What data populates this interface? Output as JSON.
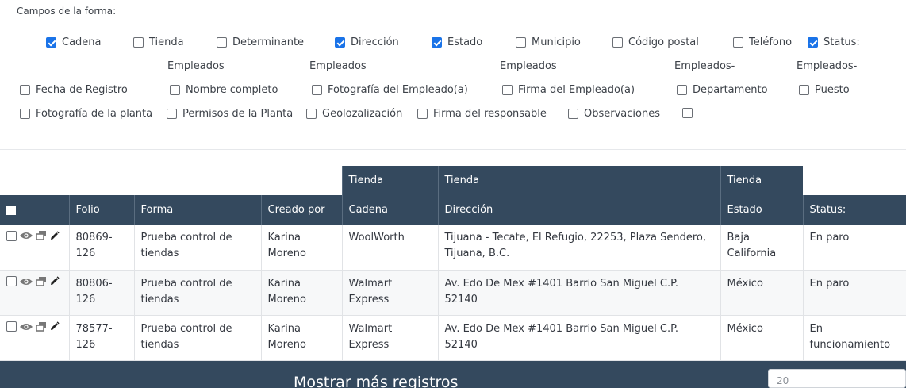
{
  "fields": {
    "title": "Campos de la forma:",
    "checkboxes": [
      {
        "label": "Cadena",
        "checked": true
      },
      {
        "label": "Tienda",
        "checked": false
      },
      {
        "label": "Determinante",
        "checked": false
      },
      {
        "label": "Dirección",
        "checked": true
      },
      {
        "label": "Estado",
        "checked": true
      },
      {
        "label": "Municipio",
        "checked": false
      },
      {
        "label": "Código postal",
        "checked": false
      },
      {
        "label": "Teléfono",
        "checked": false
      },
      {
        "label": "Status:",
        "checked": true
      },
      {
        "label": "Fecha de Registro",
        "checked": false
      },
      {
        "label": "Nombre completo",
        "checked": false
      },
      {
        "label": "Fotografía del Empleado(a)",
        "checked": false
      },
      {
        "label": "Firma del Empleado(a)",
        "checked": false
      },
      {
        "label": "Departamento",
        "checked": false
      },
      {
        "label": "Puesto",
        "checked": false
      },
      {
        "label": "Fotografía de la planta",
        "checked": false
      },
      {
        "label": "Permisos de la Planta",
        "checked": false
      },
      {
        "label": "Geolozalización",
        "checked": false
      },
      {
        "label": "Firma del responsable",
        "checked": false
      },
      {
        "label": "Observaciones",
        "checked": false
      },
      {
        "label": "",
        "checked": false
      }
    ],
    "group_labels": [
      "Empleados",
      "Empleados",
      "Empleados",
      "Empleados-",
      "Empleados-"
    ]
  },
  "table": {
    "group_headers": [
      "Tienda",
      "Tienda",
      "Tienda"
    ],
    "headers": [
      "Folio",
      "Forma",
      "Creado por",
      "Cadena",
      "Dirección",
      "Estado",
      "Status:"
    ],
    "rows": [
      {
        "folio": "80869-126",
        "forma": "Prueba control de tiendas",
        "creado": "Karina Moreno",
        "cadena": "WoolWorth",
        "direccion": "Tijuana - Tecate, El Refugio, 22253, Plaza Sendero, Tijuana, B.C.",
        "estado": "Baja California",
        "status": "En paro"
      },
      {
        "folio": "80806-126",
        "forma": "Prueba control de tiendas",
        "creado": "Karina Moreno",
        "cadena": "Walmart Express",
        "direccion": "Av. Edo De Mex #1401 Barrio San Miguel C.P. 52140",
        "estado": "México",
        "status": "En paro"
      },
      {
        "folio": "78577-126",
        "forma": "Prueba control de tiendas",
        "creado": "Karina Moreno",
        "cadena": "Walmart Express",
        "direccion": "Av. Edo De Mex #1401 Barrio San Miguel C.P. 52140",
        "estado": "México",
        "status": "En funcionamiento"
      }
    ]
  },
  "footer": {
    "more_label": "Mostrar más registros",
    "page_size_placeholder": "20"
  },
  "colors": {
    "header_bg": "#34495e",
    "checkbox_checked": "#1a73e8"
  },
  "icons": [
    "view-icon",
    "linked-screens-icon",
    "edit-pencil-icon"
  ]
}
